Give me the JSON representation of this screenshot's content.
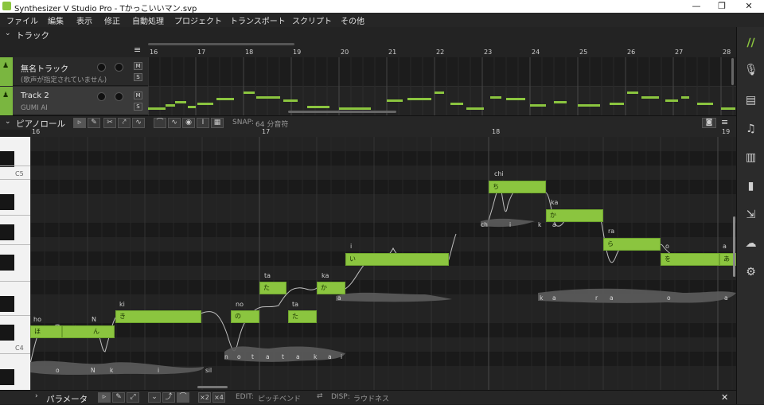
{
  "window": {
    "title": "Synthesizer V Studio Pro - Tかっこいいマン.svp",
    "minimize": "—",
    "maximize": "❐",
    "close": "✕"
  },
  "menu": [
    "ファイル",
    "編集",
    "表示",
    "修正",
    "自動処理",
    "プロジェクト",
    "トランスポート",
    "スクリプト",
    "その他"
  ],
  "track_section": {
    "title": "トラック",
    "tracks": [
      {
        "name": "無名トラック",
        "voice": "(歌声が指定されていません)",
        "mute": "M",
        "solo": "S"
      },
      {
        "name": "Track 2",
        "voice": "GUMI AI",
        "mute": "M",
        "solo": "S"
      }
    ],
    "bars": [
      "16",
      "17",
      "18",
      "19",
      "20",
      "21",
      "22",
      "23",
      "24",
      "25",
      "26",
      "27",
      "28"
    ]
  },
  "piano_roll": {
    "title": "ピアノロール",
    "snap_label": "SNAP:",
    "snap_value": "64 分音符",
    "bars": [
      "16",
      "17",
      "18",
      "19"
    ],
    "octave_labels": [
      "C5",
      "C4"
    ],
    "notes": [
      {
        "lyric": "ho",
        "text": "ほ"
      },
      {
        "lyric": "N",
        "text": "ん"
      },
      {
        "lyric": "ki",
        "text": "き"
      },
      {
        "lyric": "no",
        "text": "の"
      },
      {
        "lyric": "ta",
        "text": "た"
      },
      {
        "lyric": "ta",
        "text": "た"
      },
      {
        "lyric": "ka",
        "text": "か"
      },
      {
        "lyric": "i",
        "text": "い"
      },
      {
        "lyric": "chi",
        "text": "ち"
      },
      {
        "lyric": "ka",
        "text": "か"
      },
      {
        "lyric": "ra",
        "text": "ら"
      },
      {
        "lyric": "o",
        "text": "を"
      },
      {
        "lyric": "a",
        "text": "あ"
      }
    ],
    "phonemes": [
      "o",
      "N",
      "k",
      "i",
      "sil",
      "n",
      "o",
      "t",
      "a",
      "t",
      "a",
      "k",
      "a",
      "i",
      "a",
      "ch",
      "i",
      "k",
      "a",
      "r",
      "a",
      "o",
      "a",
      "k",
      "a"
    ]
  },
  "parameters": {
    "title": "パラメータ",
    "x2": "×2",
    "x4": "×4",
    "edit_label": "EDIT:",
    "edit_value": "ピッチベンド",
    "disp_label": "DISP:",
    "disp_value": "ラウドネス",
    "close": "✕"
  },
  "colors": {
    "accent": "#8bc53f",
    "background": "#1e1e1e"
  }
}
